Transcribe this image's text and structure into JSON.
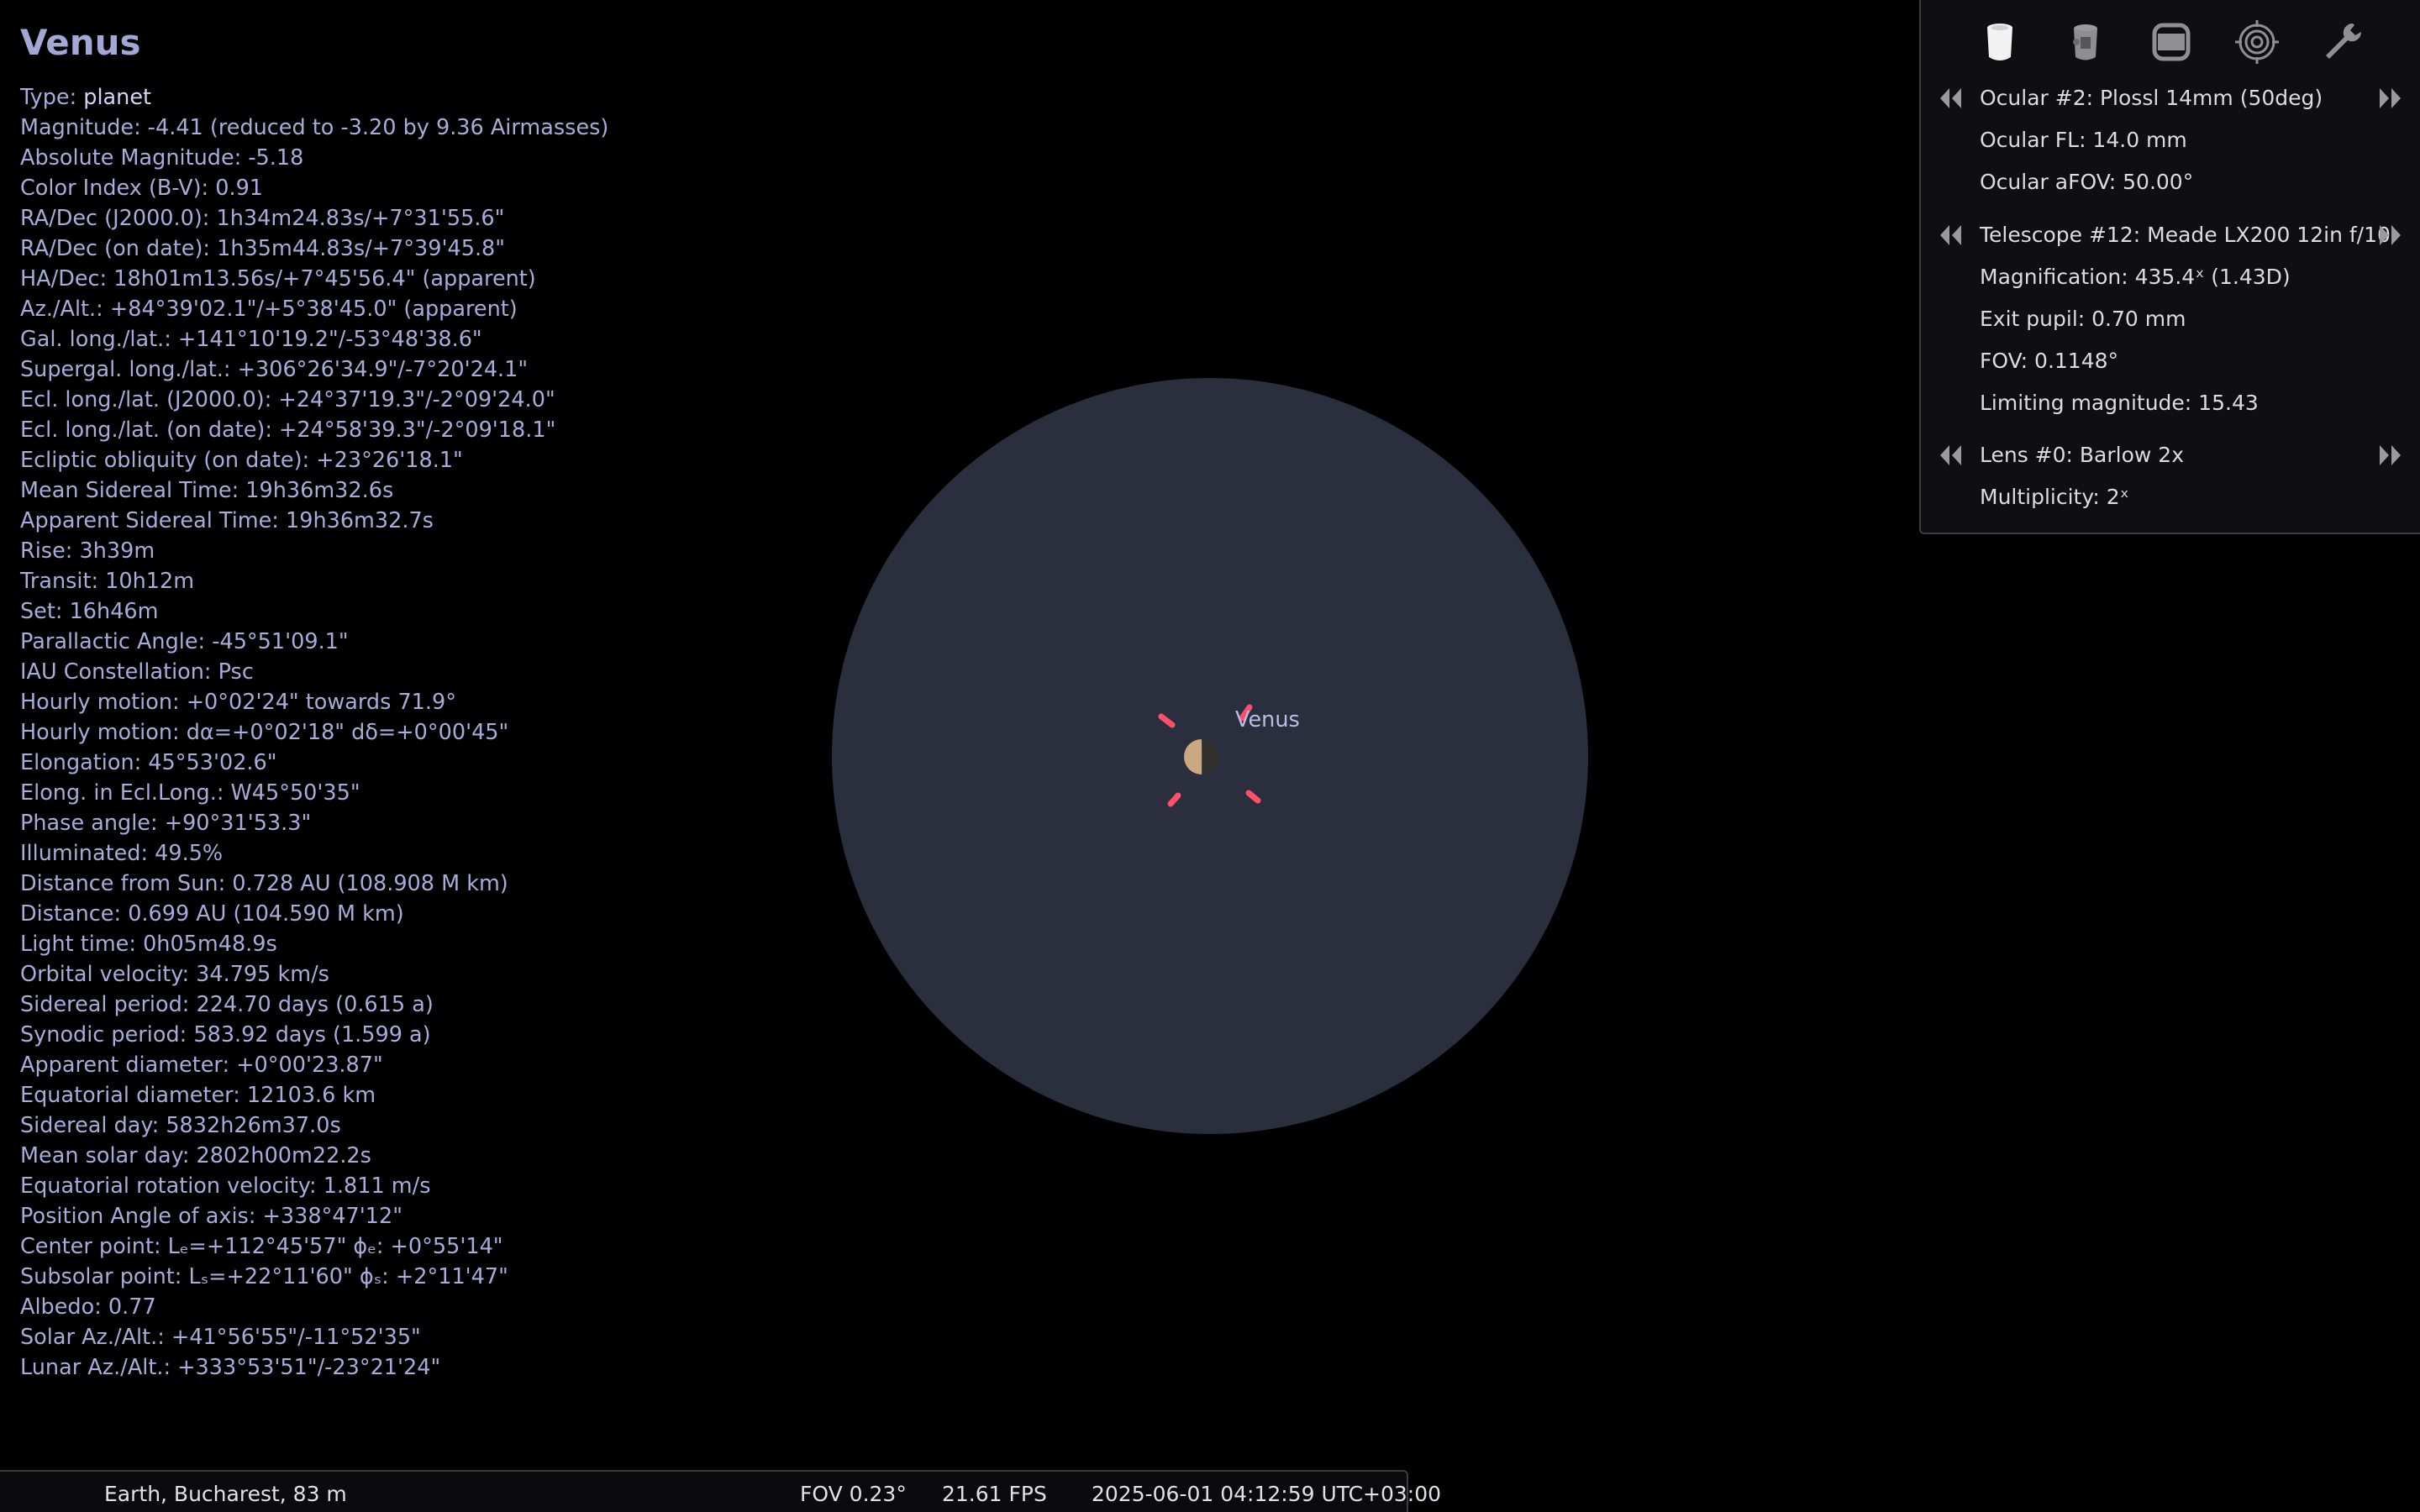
{
  "object": {
    "title": "Venus",
    "info_lines": [
      {
        "label": "Type: ",
        "value": "planet"
      },
      {
        "label": "Magnitude: ",
        "value": "-4.41 (reduced to -3.20 by 9.36 Airmasses)"
      },
      {
        "label": "Absolute Magnitude: ",
        "value": "-5.18"
      },
      {
        "label": "Color Index (B-V): ",
        "value": "0.91"
      },
      {
        "label": "RA/Dec (J2000.0): ",
        "value": "1h34m24.83s/+7°31'55.6\""
      },
      {
        "label": "RA/Dec (on date): ",
        "value": "1h35m44.83s/+7°39'45.8\""
      },
      {
        "label": "HA/Dec: ",
        "value": "18h01m13.56s/+7°45'56.4\" (apparent)"
      },
      {
        "label": "Az./Alt.: ",
        "value": "+84°39'02.1\"/+5°38'45.0\" (apparent)"
      },
      {
        "label": "Gal. long./lat.: ",
        "value": "+141°10'19.2\"/-53°48'38.6\""
      },
      {
        "label": "Supergal. long./lat.: ",
        "value": "+306°26'34.9\"/-7°20'24.1\""
      },
      {
        "label": "Ecl. long./lat. (J2000.0): ",
        "value": "+24°37'19.3\"/-2°09'24.0\""
      },
      {
        "label": "Ecl. long./lat. (on date): ",
        "value": "+24°58'39.3\"/-2°09'18.1\""
      },
      {
        "label": "Ecliptic obliquity (on date): ",
        "value": "+23°26'18.1\""
      },
      {
        "label": "Mean Sidereal Time: ",
        "value": "19h36m32.6s"
      },
      {
        "label": "Apparent Sidereal Time: ",
        "value": "19h36m32.7s"
      },
      {
        "label": "Rise: ",
        "value": "3h39m"
      },
      {
        "label": "Transit: ",
        "value": "10h12m"
      },
      {
        "label": "Set: ",
        "value": "16h46m"
      },
      {
        "label": "Parallactic Angle: ",
        "value": "-45°51'09.1\""
      },
      {
        "label": "IAU Constellation: ",
        "value": "Psc"
      },
      {
        "label": "Hourly motion: ",
        "value": "+0°02'24\" towards 71.9°"
      },
      {
        "label": "Hourly motion: ",
        "value": "dα=+0°02'18\" dδ=+0°00'45\""
      },
      {
        "label": "Elongation: ",
        "value": "45°53'02.6\""
      },
      {
        "label": "Elong. in Ecl.Long.: ",
        "value": "W45°50'35\""
      },
      {
        "label": "Phase angle: ",
        "value": "+90°31'53.3\""
      },
      {
        "label": "Illuminated: ",
        "value": "49.5%"
      },
      {
        "label": "Distance from Sun: ",
        "value": "0.728 AU (108.908 M km)"
      },
      {
        "label": "Distance: ",
        "value": "0.699 AU (104.590 M km)"
      },
      {
        "label": "Light time: ",
        "value": "0h05m48.9s"
      },
      {
        "label": "Orbital velocity: ",
        "value": "34.795 km/s"
      },
      {
        "label": "Sidereal period: ",
        "value": "224.70 days (0.615 a)"
      },
      {
        "label": "Synodic period: ",
        "value": "583.92 days (1.599 a)"
      },
      {
        "label": "Apparent diameter: ",
        "value": "+0°00'23.87\""
      },
      {
        "label": "Equatorial diameter: ",
        "value": "12103.6 km"
      },
      {
        "label": "Sidereal day: ",
        "value": "5832h26m37.0s"
      },
      {
        "label": "Mean solar day: ",
        "value": "2802h00m22.2s"
      },
      {
        "label": "Equatorial rotation velocity: ",
        "value": "1.811 m/s"
      },
      {
        "label": "Position Angle of axis: ",
        "value": "+338°47'12\""
      },
      {
        "label": "Center point: ",
        "value": "Lₑ=+112°45'57\" ϕₑ: +0°55'14\""
      },
      {
        "label": "Subsolar point: ",
        "value": "Lₛ=+22°11'60\" ϕₛ: +2°11'47\""
      },
      {
        "label": "Albedo: ",
        "value": "0.77"
      },
      {
        "label": "Solar Az./Alt.: ",
        "value": "+41°56'55\"/-11°52'35\""
      },
      {
        "label": "Lunar Az./Alt.: ",
        "value": "+333°53'51\"/-23°21'24\""
      }
    ]
  },
  "sky_view": {
    "label": "Venus",
    "illuminated_fraction": 0.495,
    "colors": {
      "field": "#2b2e3c",
      "planet_lit": "#c9a882",
      "marker": "#ff4f6a"
    }
  },
  "oculars_panel": {
    "tools": [
      {
        "name": "ocular-tool-icon",
        "icon": "ocular-icon",
        "active": true
      },
      {
        "name": "ccd-tool-icon",
        "icon": "crosshair-telescope-icon",
        "active": false
      },
      {
        "name": "sensor-frame-tool-icon",
        "icon": "sensor-frame-icon",
        "active": false
      },
      {
        "name": "telrad-tool-icon",
        "icon": "telrad-icon",
        "active": false
      },
      {
        "name": "config-tool-icon",
        "icon": "wrench-icon",
        "active": false
      }
    ],
    "ocular": {
      "name": "Ocular #2: Plossl 14mm (50deg)",
      "fl": "Ocular FL: 14.0 mm",
      "afov": "Ocular aFOV: 50.00°"
    },
    "telescope": {
      "name": "Telescope #12: Meade  LX200 12in f/10",
      "magnification": "Magnification: 435.4ˣ (1.43D)",
      "exit_pupil": "Exit pupil: 0.70 mm",
      "fov": "FOV: 0.1148°",
      "limiting_magnitude": "Limiting magnitude: 15.43"
    },
    "lens": {
      "name": "Lens #0: Barlow 2x",
      "multiplicity": "Multiplicity: 2ˣ"
    }
  },
  "status_bar": {
    "location": "Earth, Bucharest, 83 m",
    "fov": "FOV 0.23°",
    "fps": "21.61 FPS",
    "datetime": "2025-06-01 04:12:59 UTC+03:00"
  }
}
